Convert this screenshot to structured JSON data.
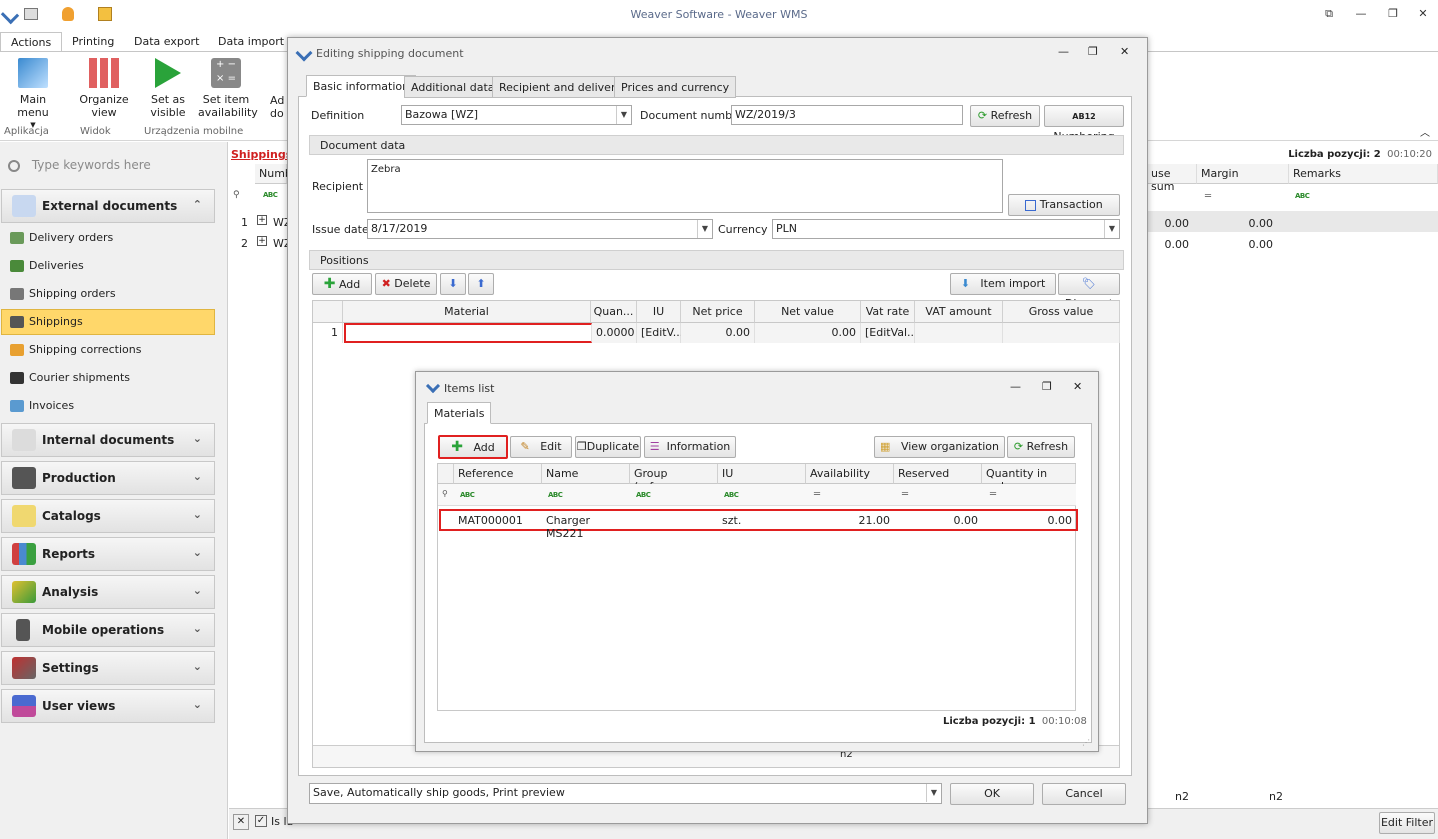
{
  "app": {
    "title": "Weaver Software - Weaver WMS"
  },
  "ribbon": {
    "tabs": [
      "Actions",
      "Printing",
      "Data export",
      "Data import"
    ],
    "buttons": {
      "main_menu": "Main menu",
      "organize_view_1": "Organize",
      "organize_view_2": "view",
      "set_visible_1": "Set as",
      "set_visible_2": "visible",
      "set_availability_1": "Set item",
      "set_availability_2": "availability",
      "partial_1": "Ad",
      "partial_2": "do"
    },
    "groups": [
      "Aplikacja",
      "Widok",
      "Urządzenia mobilne"
    ]
  },
  "sidebar": {
    "search_placeholder": "Type keywords here",
    "external_documents": "External documents",
    "items": [
      "Delivery orders",
      "Deliveries",
      "Shipping orders",
      "Shippings",
      "Shipping corrections",
      "Courier shipments",
      "Invoices"
    ],
    "groups": [
      "Internal documents",
      "Production",
      "Catalogs",
      "Reports",
      "Analysis",
      "Mobile operations",
      "Settings",
      "User views"
    ]
  },
  "main_grid": {
    "breadcrumb": "Shippings",
    "count_label": "Liczba pozycji: 2",
    "time": "00:10:20",
    "col_number": "Numb",
    "col_use_sum": "use sum",
    "col_margin": "Margin",
    "col_remarks": "Remarks",
    "rows": [
      {
        "num": "1",
        "ref": "WZ",
        "use_sum": "0.00",
        "margin": "0.00"
      },
      {
        "num": "2",
        "ref": "WZ",
        "use_sum": "0.00",
        "margin": "0.00"
      }
    ],
    "footer_n2_1": "n2",
    "footer_n2_2": "n2",
    "footer_filter": "Is la",
    "edit_filter": "Edit Filter"
  },
  "dialog": {
    "title": "Editing shipping document",
    "tabs": [
      "Basic information",
      "Additional data",
      "Recipient and delivery",
      "Prices and currency"
    ],
    "definition_label": "Definition",
    "definition_value": "Bazowa [WZ]",
    "docnum_label": "Document number",
    "docnum_value": "WZ/2019/3",
    "refresh": "Refresh",
    "numbering": "Numbering",
    "document_data": "Document data",
    "recipient_label": "Recipient",
    "recipient_value": "Zebra",
    "transaction_history": "Transaction history",
    "issue_date_label": "Issue date",
    "issue_date_value": "8/17/2019",
    "currency_label": "Currency",
    "currency_value": "PLN",
    "positions": "Positions",
    "add": "Add",
    "delete": "Delete",
    "item_import": "Item import",
    "discount": "Discount",
    "columns": [
      "Material",
      "Quan...",
      "IU",
      "Net price",
      "Net value",
      "Vat rate",
      "VAT amount",
      "Gross value"
    ],
    "row": {
      "num": "1",
      "material": "",
      "qty": "0.0000",
      "iu": "[EditV...",
      "net_price": "0.00",
      "net_value": "0.00",
      "vat_rate": "[EditVal...",
      "vat_amount": "",
      "gross": ""
    },
    "footer_n2": "n2",
    "action_value": "Save, Automatically ship goods, Print preview",
    "ok": "OK",
    "cancel": "Cancel"
  },
  "items_list": {
    "title": "Items list",
    "tab": "Materials",
    "add": "Add",
    "edit": "Edit",
    "duplicate": "Duplicate",
    "information": "Information",
    "view_organization": "View organization",
    "refresh": "Refresh",
    "columns": [
      "Reference",
      "Name",
      "Group (refere...",
      "IU",
      "Availability",
      "Reserved amo...",
      "Quantity in ord..."
    ],
    "rows": [
      {
        "reference": "MAT000001",
        "name": "Charger MS221",
        "group": "",
        "iu": "szt.",
        "availability": "21.00",
        "reserved": "0.00",
        "in_order": "0.00"
      }
    ],
    "count_label": "Liczba pozycji: 1",
    "time": "00:10:08"
  }
}
